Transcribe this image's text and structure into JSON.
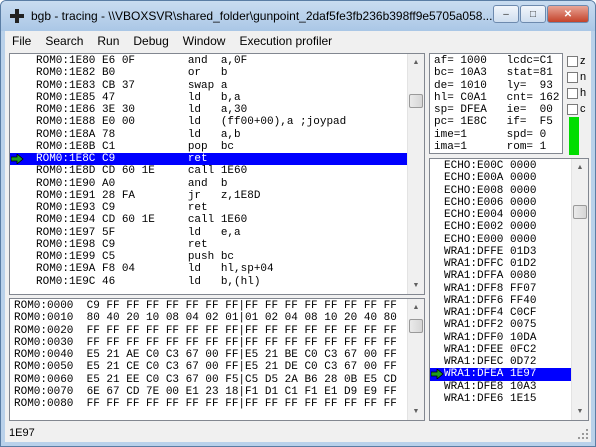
{
  "window": {
    "title": "bgb - tracing - \\\\VBOXSVR\\shared_folder\\gunpoint_2daf5fe3fb236b398ff9e5705a058...",
    "minimize_label": "–",
    "maximize_label": "□",
    "close_label": "✕"
  },
  "menu": [
    "File",
    "Search",
    "Run",
    "Debug",
    "Window",
    "Execution profiler"
  ],
  "disassembly": {
    "rows": [
      "ROM0:1E80 E6 0F        and  a,0F",
      "ROM0:1E82 B0           or   b",
      "ROM0:1E83 CB 37        swap a",
      "ROM0:1E85 47           ld   b,a",
      "ROM0:1E86 3E 30        ld   a,30",
      "ROM0:1E88 E0 00        ld   (ff00+00),a ;joypad",
      "ROM0:1E8A 78           ld   a,b",
      "ROM0:1E8B C1           pop  bc",
      "ROM0:1E8C C9           ret",
      "ROM0:1E8D CD 60 1E     call 1E60",
      "ROM0:1E90 A0           and  b",
      "ROM0:1E91 28 FA        jr   z,1E8D",
      "ROM0:1E93 C9           ret",
      "ROM0:1E94 CD 60 1E     call 1E60",
      "ROM0:1E97 5F           ld   e,a",
      "ROM0:1E98 C9           ret",
      "ROM0:1E99 C5           push bc",
      "ROM0:1E9A F8 04        ld   hl,sp+04",
      "ROM0:1E9C 46           ld   b,(hl)"
    ],
    "selected_index": 8
  },
  "registers": {
    "rows": [
      "af= 1000   lcdc=C1",
      "bc= 10A3   stat=81",
      "de= 1010   ly=  93",
      "hl= C0A1   cnt= 162",
      "sp= DFEA   ie=  00",
      "pc= 1E8C   if=  F5",
      "ime=1      spd= 0",
      "ima=1      rom= 1"
    ]
  },
  "flags": [
    "z",
    "n",
    "h",
    "c"
  ],
  "stack": {
    "rows": [
      "ECHO:E00C 0000",
      "ECHO:E00A 0000",
      "ECHO:E008 0000",
      "ECHO:E006 0000",
      "ECHO:E004 0000",
      "ECHO:E002 0000",
      "ECHO:E000 0000",
      "WRA1:DFFE 01D3",
      "WRA1:DFFC 01D2",
      "WRA1:DFFA 0080",
      "WRA1:DFF8 FF07",
      "WRA1:DFF6 FF40",
      "WRA1:DFF4 C0CF",
      "WRA1:DFF2 0075",
      "WRA1:DFF0 10DA",
      "WRA1:DFEE 0FC2",
      "WRA1:DFEC 0D72",
      "WRA1:DFEA 1E97",
      "WRA1:DFE8 10A3",
      "WRA1:DFE6 1E15"
    ],
    "selected_index": 17
  },
  "memory": {
    "rows": [
      "ROM0:0000  C9 FF FF FF FF FF FF FF|FF FF FF FF FF FF FF FF",
      "ROM0:0010  80 40 20 10 08 04 02 01|01 02 04 08 10 20 40 80",
      "ROM0:0020  FF FF FF FF FF FF FF FF|FF FF FF FF FF FF FF FF",
      "ROM0:0030  FF FF FF FF FF FF FF FF|FF FF FF FF FF FF FF FF",
      "ROM0:0040  E5 21 AE C0 C3 67 00 FF|E5 21 BE C0 C3 67 00 FF",
      "ROM0:0050  E5 21 CE C0 C3 67 00 FF|E5 21 DE C0 C3 67 00 FF",
      "ROM0:0060  E5 21 EE C0 C3 67 00 F5|C5 D5 2A B6 28 0B E5 CD",
      "ROM0:0070  6E 67 CD 7E 00 E1 23 18|F1 D1 C1 F1 E1 D9 E9 FF",
      "ROM0:0080  FF FF FF FF FF FF FF FF|FF FF FF FF FF FF FF FF"
    ]
  },
  "status": {
    "text": "1E97"
  },
  "colors": {
    "selection": "#0000ff",
    "green_indicator": "#00dd00",
    "arrow": "#1e9a1e"
  }
}
